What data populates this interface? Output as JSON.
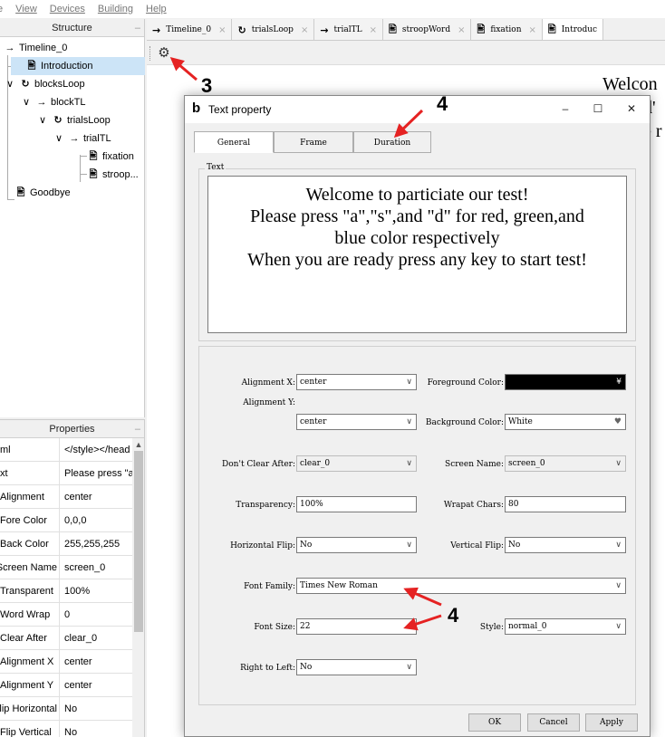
{
  "menubar": {
    "items": [
      "e",
      "View",
      "Devices",
      "Building",
      "Help"
    ]
  },
  "structure": {
    "title": "Structure",
    "dock": "–",
    "items": [
      {
        "label": "Timeline_0",
        "icon": "→"
      },
      {
        "label": "Introduction",
        "icon": "🖹"
      },
      {
        "label": "blocksLoop",
        "icon": "↻",
        "expander": "∨"
      },
      {
        "label": "blockTL",
        "icon": "→",
        "expander": "∨"
      },
      {
        "label": "trialsLoop",
        "icon": "↻",
        "expander": "∨"
      },
      {
        "label": "trialTL",
        "icon": "→",
        "expander": "∨"
      },
      {
        "label": "fixation",
        "icon": "🖹"
      },
      {
        "label": "stroop...",
        "icon": "🖹"
      },
      {
        "label": "Goodbye",
        "icon": "🖹"
      }
    ]
  },
  "properties": {
    "title": "Properties",
    "dock": "–",
    "rows": [
      {
        "name": "ml",
        "value": "</style></head"
      },
      {
        "name": "xt",
        "value": "Please press \"a"
      },
      {
        "name": "Alignment",
        "value": "center"
      },
      {
        "name": "Fore Color",
        "value": "0,0,0"
      },
      {
        "name": "Back Color",
        "value": "255,255,255"
      },
      {
        "name": "Screen Name",
        "value": "screen_0"
      },
      {
        "name": "Transparent",
        "value": "100%"
      },
      {
        "name": "Word Wrap",
        "value": "0"
      },
      {
        "name": "Clear After",
        "value": "clear_0"
      },
      {
        "name": "Alignment X",
        "value": "center"
      },
      {
        "name": "Alignment Y",
        "value": "center"
      },
      {
        "name": "Flip Horizontal",
        "value": "No"
      },
      {
        "name": "Flip Vertical",
        "value": "No"
      }
    ]
  },
  "tabs": [
    {
      "label": "Timeline_0",
      "icon": "→"
    },
    {
      "label": "trialsLoop",
      "icon": "↻"
    },
    {
      "label": "trialTL",
      "icon": "→"
    },
    {
      "label": "stroopWord",
      "icon": "🖹"
    },
    {
      "label": "fixation",
      "icon": "🖹"
    },
    {
      "label": "Introduc",
      "icon": "🖹"
    }
  ],
  "tab_close": "×",
  "canvas": {
    "lines": [
      "Welcon",
      "d'",
      "e r"
    ]
  },
  "dialog": {
    "logo": "b",
    "title": "Text property",
    "minimize": "–",
    "maximize": "☐",
    "close": "✕",
    "tabs": [
      "General",
      "Frame",
      "Duration"
    ],
    "text_group_title": "Text",
    "text_content": [
      "Welcome to particiate our test!",
      "Please press \"a\",\"s\",and \"d\" for red, green,and",
      "blue color respectively",
      "When you are ready press any key to start test!"
    ],
    "fields": {
      "alignment_x": {
        "label": "Alignment X:",
        "value": "center"
      },
      "alignment_y": {
        "label": "Alignment Y:",
        "value": "center"
      },
      "foreground_color": {
        "label": "Foreground Color:",
        "value": "",
        "color": "#000000"
      },
      "background_color": {
        "label": "Background Color:",
        "value": "White",
        "color": "#ffffff"
      },
      "dont_clear_after": {
        "label": "Don't Clear After:",
        "value": "clear_0"
      },
      "screen_name": {
        "label": "Screen Name:",
        "value": "screen_0"
      },
      "transparency": {
        "label": "Transparency:",
        "value": "100%"
      },
      "wrapat_chars": {
        "label": "Wrapat Chars:",
        "value": "80"
      },
      "horizontal_flip": {
        "label": "Horizontal Flip:",
        "value": "No"
      },
      "vertical_flip": {
        "label": "Vertical Flip:",
        "value": "No"
      },
      "font_family": {
        "label": "Font Family:",
        "value": "Times New Roman"
      },
      "font_size": {
        "label": "Font Size:",
        "value": "22"
      },
      "style": {
        "label": "Style:",
        "value": "normal_0"
      },
      "right_to_left": {
        "label": "Right to Left:",
        "value": "No"
      }
    },
    "buttons": {
      "ok": "OK",
      "cancel": "Cancel",
      "apply": "Apply"
    }
  },
  "annotations": {
    "labels": [
      "3",
      "4",
      "4"
    ],
    "arrow_color": "#e52222"
  },
  "colors": {
    "selection": "#cce4f7",
    "panel_bg": "#f0f0f0"
  }
}
